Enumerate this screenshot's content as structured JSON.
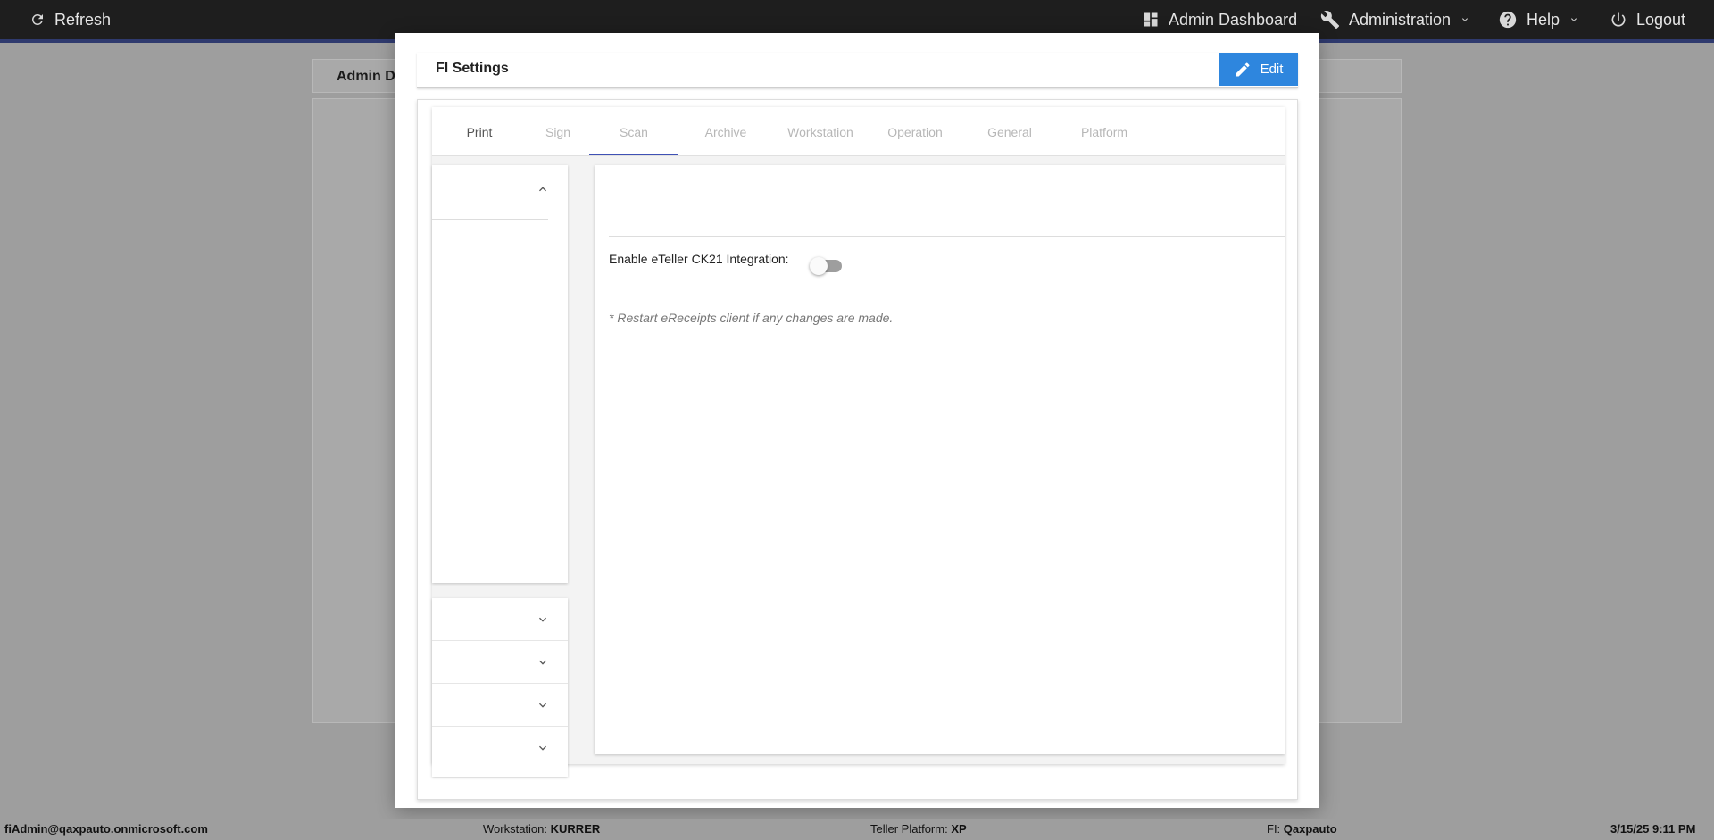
{
  "topbar": {
    "refresh_label": "Refresh",
    "admin_dashboard_label": "Admin Dashboard",
    "administration_label": "Administration",
    "help_label": "Help",
    "logout_label": "Logout"
  },
  "background": {
    "page_title": "Admin D"
  },
  "modal": {
    "title": "FI Settings",
    "edit_label": "Edit",
    "tabs": [
      {
        "label": "Print"
      },
      {
        "label": "Sign"
      },
      {
        "label": "Scan"
      },
      {
        "label": "Archive"
      },
      {
        "label": "Workstation"
      },
      {
        "label": "Operation"
      },
      {
        "label": "General"
      },
      {
        "label": "Platform"
      }
    ],
    "active_tab": "Scan",
    "main": {
      "integration_label": "Enable eTeller CK21 Integration:",
      "integration_enabled": false,
      "note": "* Restart eReceipts client if any changes are made."
    }
  },
  "statusbar": {
    "user": "fiAdmin@qaxpauto.onmicrosoft.com",
    "workstation_label": "Workstation:",
    "workstation_value": "KURRER",
    "platform_label": "Teller Platform:",
    "platform_value": "XP",
    "fi_label": "FI:",
    "fi_value": "Qaxpauto",
    "datetime": "3/15/25 9:11 PM"
  },
  "colors": {
    "accent": "#2e86de",
    "tab_indicator": "#3f51b5",
    "topbar": "#1e1e1e"
  }
}
